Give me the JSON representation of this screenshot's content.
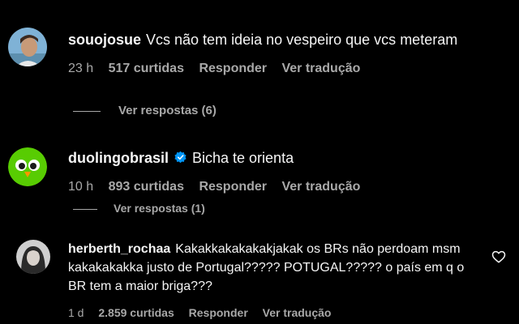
{
  "comments": [
    {
      "username": "souojosue",
      "text": "Vcs não tem ideia no vespeiro que vcs meteram",
      "time": "23 h",
      "likes": "517 curtidas",
      "reply_label": "Responder",
      "translate_label": "Ver tradução",
      "view_replies": "Ver respostas (6)"
    },
    {
      "username": "duolingobrasil",
      "verified": true,
      "text": "Bicha te orienta",
      "time": "10 h",
      "likes": "893 curtidas",
      "reply_label": "Responder",
      "translate_label": "Ver tradução",
      "view_replies": "Ver respostas (1)"
    },
    {
      "username": "herberth_rochaa",
      "text": "Kakakkakakakakjakak os BRs não perdoam msm kakakakakka justo de Portugal????? POTUGAL????? o país em q o BR tem a maior briga???",
      "time": "1 d",
      "likes": "2.859 curtidas",
      "reply_label": "Responder",
      "translate_label": "Ver tradução"
    }
  ],
  "colors": {
    "background": "#000000",
    "text": "#f5f5f5",
    "secondary": "#a8a8a8",
    "verified_blue": "#0095f6",
    "duolingo_green": "#58cc02"
  },
  "icons": [
    "verified-badge-icon",
    "heart-icon"
  ]
}
